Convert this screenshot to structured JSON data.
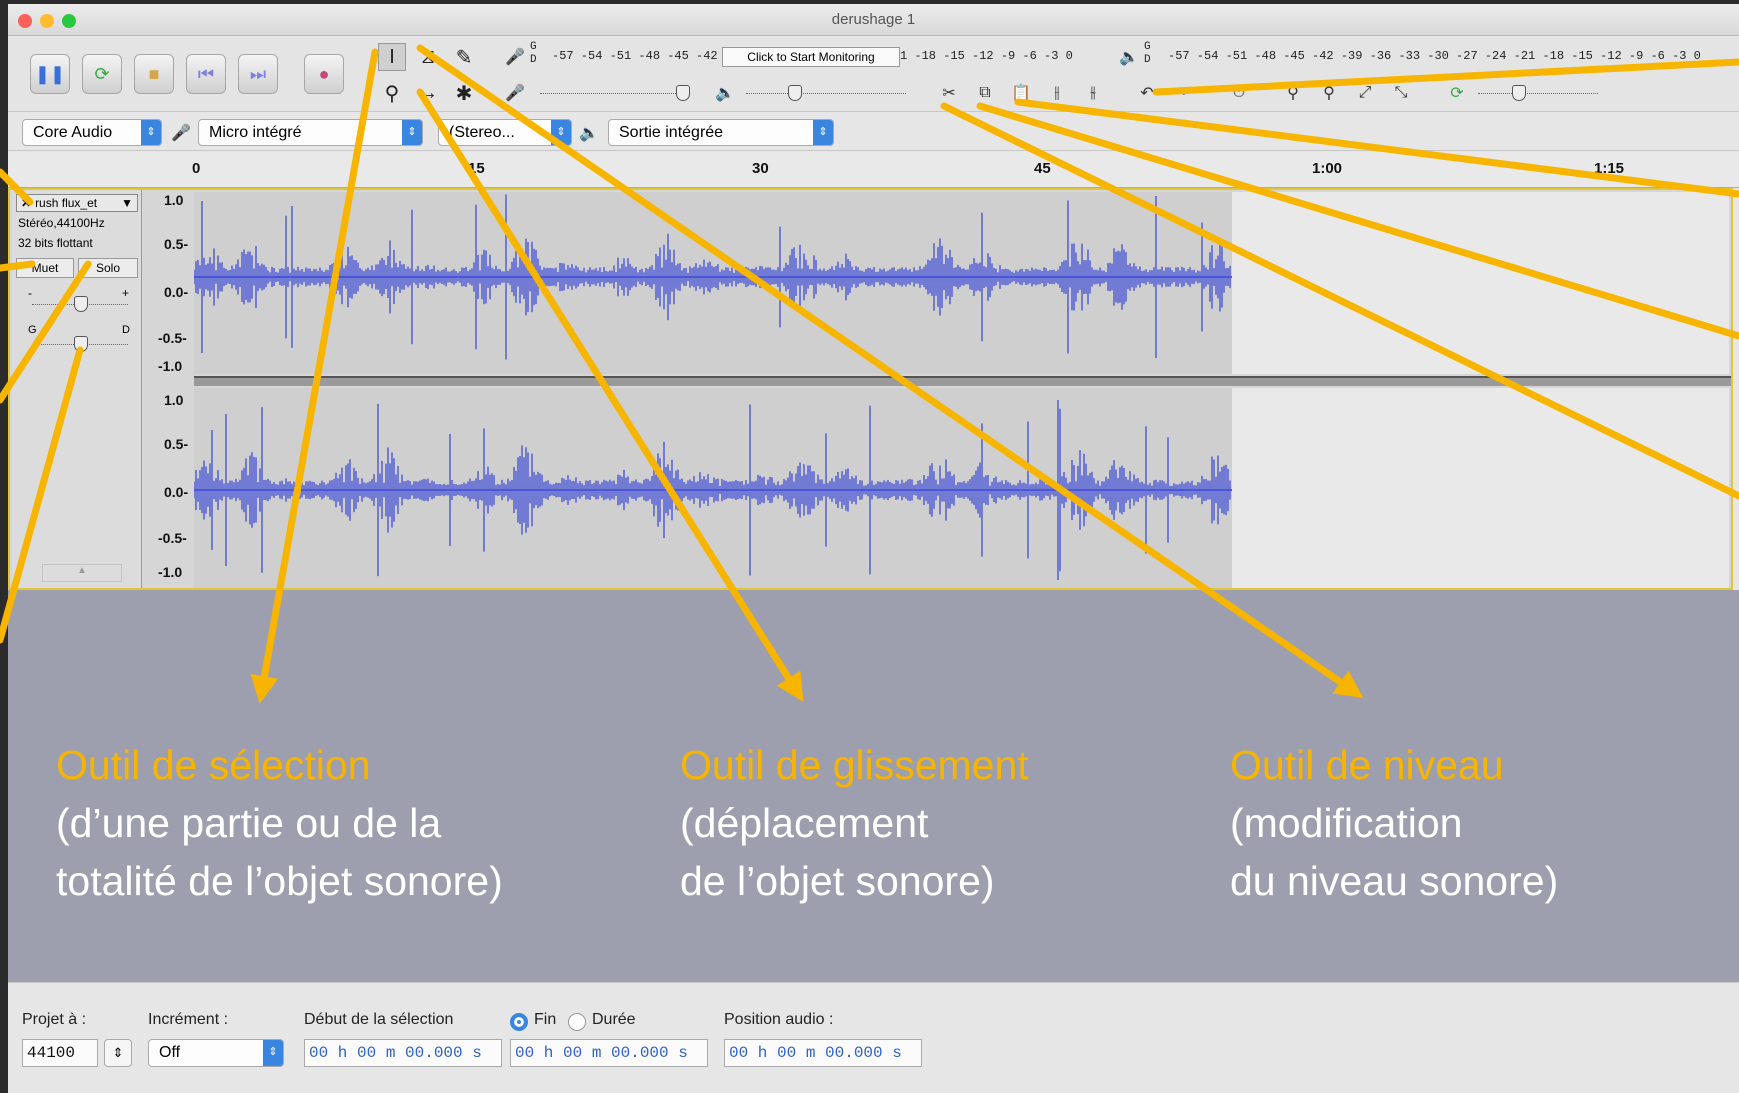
{
  "window": {
    "title": "derushage 1"
  },
  "meters": {
    "rec_scale": "-57 -54 -51 -48 -45 -42 -",
    "monitor_label": "Click to Start Monitoring",
    "rec_scale_right": "1 -18 -15 -12  -9  -6  -3  0",
    "play_scale": "-57 -54 -51 -48 -45 -42 -39 -36 -33 -30 -27 -24 -21 -18 -15 -12  -9  -6  -3  0",
    "gd_rec": "G D",
    "gd_play": "G D"
  },
  "devices": {
    "host": "Core Audio",
    "input": "Micro intégré",
    "channels": "(Stereo...",
    "output": "Sortie intégrée"
  },
  "ruler": {
    "ticks": [
      "0",
      "15",
      "30",
      "45",
      "1:00",
      "1:15"
    ]
  },
  "track": {
    "name": "rush flux_et",
    "format": "Stéréo,44100Hz",
    "bits": "32 bits flottant",
    "mute": "Muet",
    "solo": "Solo",
    "gain_minus": "-",
    "gain_plus": "+",
    "pan_left": "G",
    "pan_right": "D",
    "scale": [
      "1.0",
      "0.5-",
      "0.0-",
      "-0.5-",
      "-1.0"
    ]
  },
  "captions": [
    {
      "title": "Outil de sélection",
      "line1": "(d’une partie ou de la",
      "line2": "totalité de l’objet sonore)"
    },
    {
      "title": "Outil de glissement",
      "line1": "(déplacement",
      "line2": "de l’objet sonore)"
    },
    {
      "title": "Outil de niveau",
      "line1": "(modification",
      "line2": "du niveau sonore)"
    }
  ],
  "status": {
    "project_rate_label": "Projet à :",
    "project_rate": "44100",
    "snap_label": "Incrément :",
    "snap_value": "Off",
    "selection_start_label": "Début de la sélection",
    "end_label": "Fin",
    "duration_label": "Durée",
    "audio_position_label": "Position audio :",
    "sel_start": "00 h 00 m 00.000 s",
    "sel_end": "00 h 00 m 00.000 s",
    "audio_pos": "00 h 00 m 00.000 s"
  },
  "colors": {
    "waveform": "#4b57d6",
    "annotation": "#f7b500",
    "selection_border": "#e0c73a"
  },
  "icons": [
    "pause-icon",
    "loop-icon",
    "stop-icon",
    "skip-start-icon",
    "skip-end-icon",
    "record-icon",
    "selection-tool-icon",
    "envelope-tool-icon",
    "draw-tool-icon",
    "zoom-tool-icon",
    "time-shift-tool-icon",
    "multi-tool-icon",
    "mic-icon",
    "speaker-icon",
    "cut-icon",
    "copy-icon",
    "paste-icon",
    "trim-icon",
    "silence-icon",
    "undo-icon",
    "redo-icon"
  ]
}
